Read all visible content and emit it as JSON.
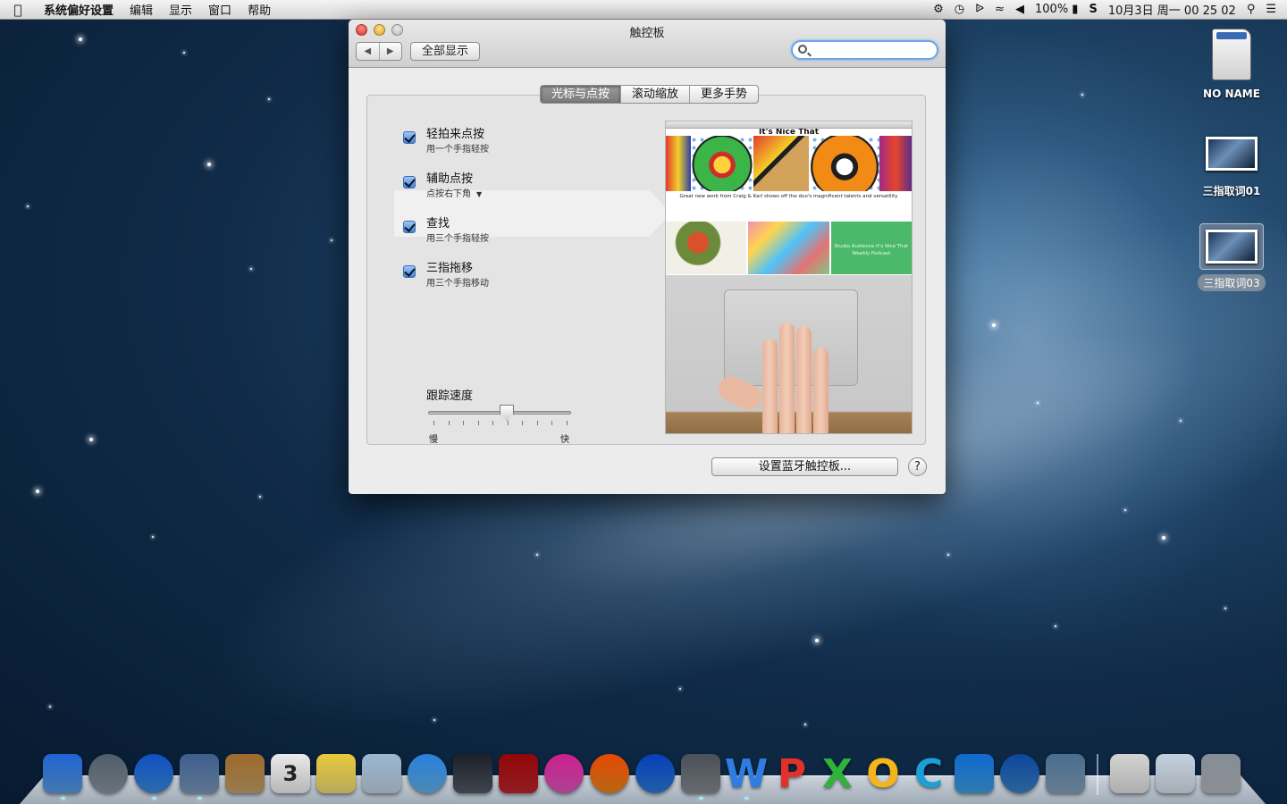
{
  "menubar": {
    "app_name": "系统偏好设置",
    "items": [
      "编辑",
      "显示",
      "窗口",
      "帮助"
    ],
    "battery": "100%",
    "clock": "10月3日 周一  00 25 02"
  },
  "window": {
    "title": "触控板",
    "show_all": "全部显示",
    "search_placeholder": "",
    "tabs": [
      "光标与点按",
      "滚动缩放",
      "更多手势"
    ],
    "active_tab": "光标与点按",
    "options": [
      {
        "title": "轻拍来点按",
        "subtitle": "用一个手指轻按",
        "checked": true
      },
      {
        "title": "辅助点按",
        "subtitle": "点按右下角",
        "checked": true,
        "has_dropdown": true
      },
      {
        "title": "查找",
        "subtitle": "用三个手指轻按",
        "checked": true,
        "selected": true
      },
      {
        "title": "三指拖移",
        "subtitle": "用三个手指移动",
        "checked": true
      }
    ],
    "tracking_speed": {
      "label": "跟踪速度",
      "min_label": "慢",
      "max_label": "快",
      "value_fraction": 0.55
    },
    "preview": {
      "site_title": "It's Nice That",
      "caption": "Great new work from Craig & Karl shows off the duo's magnificent talents and versatility",
      "tile_text": "Studio Audience It's Nice That Weekly Podcast"
    },
    "bluetooth_button": "设置蓝牙触控板...",
    "help": "?"
  },
  "desktop_icons": [
    {
      "label": "NO NAME",
      "kind": "drive"
    },
    {
      "label": "三指取词01",
      "kind": "screenshot"
    },
    {
      "label": "三指取词03",
      "kind": "screenshot",
      "selected": true
    }
  ],
  "dock": {
    "apps": [
      {
        "name": "finder-icon",
        "color": "#5aa0e8"
      },
      {
        "name": "launchpad-icon",
        "color": "#8f9aa5"
      },
      {
        "name": "safari-icon",
        "color": "#3d8fe0"
      },
      {
        "name": "mail-icon",
        "color": "#7d9cbf"
      },
      {
        "name": "contacts-icon",
        "color": "#c9a46b"
      },
      {
        "name": "calendar-icon",
        "color": "#f4f4f4",
        "text": "3"
      },
      {
        "name": "notes-icon",
        "color": "#f3e27b"
      },
      {
        "name": "preview-icon",
        "color": "#c7d8e8"
      },
      {
        "name": "messages-icon",
        "color": "#66b6ee"
      },
      {
        "name": "facetime-icon",
        "color": "#555c66"
      },
      {
        "name": "photo-booth-icon",
        "color": "#c1272d"
      },
      {
        "name": "itunes-icon",
        "color": "#e45ac0"
      },
      {
        "name": "ibooks-icon",
        "color": "#f2891d"
      },
      {
        "name": "app-store-icon",
        "color": "#2d7fdb"
      },
      {
        "name": "system-preferences-icon",
        "color": "#8a8f96"
      },
      {
        "name": "word-icon",
        "color": "#2f7de1",
        "letter": "W"
      },
      {
        "name": "powerpoint-icon",
        "color": "#e0312a",
        "letter": "P"
      },
      {
        "name": "excel-icon",
        "color": "#2fb33a",
        "letter": "X"
      },
      {
        "name": "outlook-icon",
        "color": "#f3b51c",
        "letter": "O"
      },
      {
        "name": "communicator-icon",
        "color": "#1c9fd6",
        "letter": "C"
      },
      {
        "name": "messenger-icon",
        "color": "#3fa4e6"
      },
      {
        "name": "network-icon",
        "color": "#3a86c9"
      },
      {
        "name": "remote-desktop-icon",
        "color": "#88a7c0"
      }
    ],
    "extras": [
      {
        "name": "document-stack-icon",
        "color": "#e8e8e8"
      },
      {
        "name": "screenshot-stack-icon",
        "color": "#dfe7ef"
      },
      {
        "name": "trash-icon",
        "color": "#b8bec4"
      }
    ]
  }
}
